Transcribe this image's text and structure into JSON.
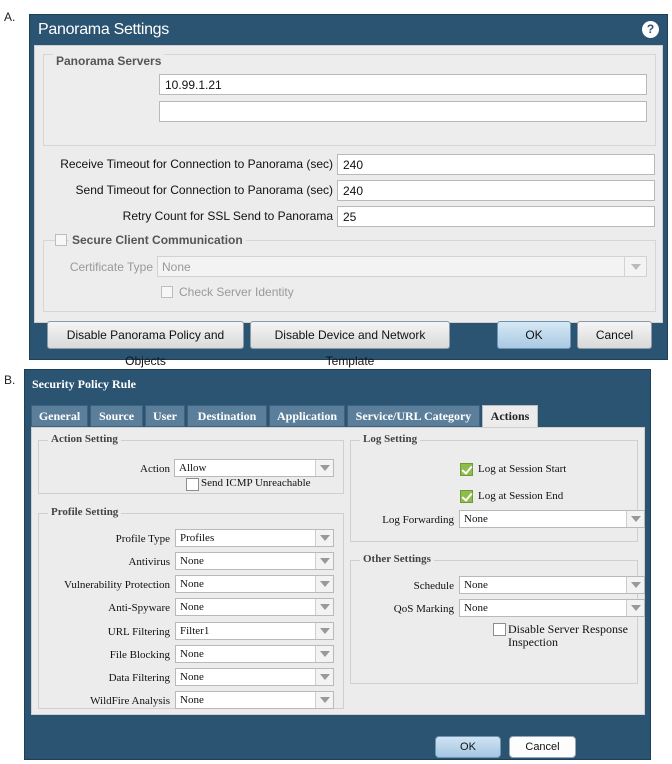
{
  "labels": {
    "a": "A.",
    "b": "B."
  },
  "panorama": {
    "title": "Panorama Settings",
    "help_icon": "question-circle-icon",
    "servers_legend": "Panorama Servers",
    "server1": "10.99.1.21",
    "server2": "",
    "receive_timeout_label": "Receive Timeout for Connection to Panorama (sec)",
    "receive_timeout": "240",
    "send_timeout_label": "Send Timeout for Connection to Panorama (sec)",
    "send_timeout": "240",
    "retry_label": "Retry Count for SSL Send to Panorama",
    "retry": "25",
    "secure_legend": "Secure Client Communication",
    "cert_label": "Certificate Type",
    "cert_value": "None",
    "check_identity_label": "Check Server Identity",
    "btn_disable_policy": "Disable Panorama Policy and Objects",
    "btn_disable_template": "Disable Device and Network Template",
    "btn_ok": "OK",
    "btn_cancel": "Cancel"
  },
  "rule": {
    "title": "Security Policy Rule",
    "tabs": [
      "General",
      "Source",
      "User",
      "Destination",
      "Application",
      "Service/URL Category",
      "Actions"
    ],
    "active_tab": "Actions",
    "action_setting": {
      "legend": "Action Setting",
      "action_label": "Action",
      "action_value": "Allow",
      "icmp_label": "Send ICMP Unreachable"
    },
    "profile_setting": {
      "legend": "Profile Setting",
      "rows": [
        {
          "label": "Profile Type",
          "value": "Profiles"
        },
        {
          "label": "Antivirus",
          "value": "None"
        },
        {
          "label": "Vulnerability Protection",
          "value": "None"
        },
        {
          "label": "Anti-Spyware",
          "value": "None"
        },
        {
          "label": "URL Filtering",
          "value": "Filter1"
        },
        {
          "label": "File Blocking",
          "value": "None"
        },
        {
          "label": "Data Filtering",
          "value": "None"
        },
        {
          "label": "WildFire Analysis",
          "value": "None"
        }
      ]
    },
    "log_setting": {
      "legend": "Log Setting",
      "log_start": "Log at Session Start",
      "log_end": "Log at Session End",
      "forwarding_label": "Log Forwarding",
      "forwarding_value": "None"
    },
    "other_settings": {
      "legend": "Other Settings",
      "schedule_label": "Schedule",
      "schedule_value": "None",
      "qos_label": "QoS Marking",
      "qos_value": "None",
      "disable_response_line1": "Disable Server Response",
      "disable_response_line2": "Inspection"
    },
    "btn_ok": "OK",
    "btn_cancel": "Cancel"
  }
}
